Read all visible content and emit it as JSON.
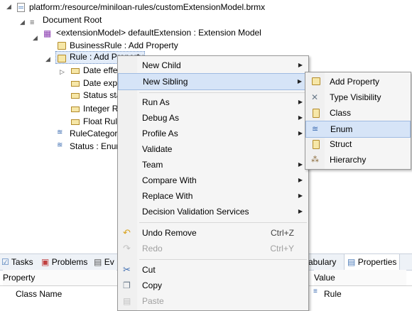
{
  "tree": {
    "file_path": "platform:/resource/miniloan-rules/customExtensionModel.brmx",
    "document_root": "Document Root",
    "extension_model": "<extensionModel> defaultExtension : Extension Model",
    "business_rule": "BusinessRule : Add Property",
    "rule": "Rule : Add Property",
    "rule_children": [
      "Date effe",
      "Date expi",
      "Status sta",
      "Integer R",
      "Float Rule"
    ],
    "rule_category": "RuleCategory",
    "status": "Status : Enum"
  },
  "context_menu": {
    "new_child": "New Child",
    "new_sibling": "New Sibling",
    "run_as": "Run As",
    "debug_as": "Debug As",
    "profile_as": "Profile As",
    "validate": "Validate",
    "team": "Team",
    "compare_with": "Compare With",
    "replace_with": "Replace With",
    "decision_validation": "Decision Validation Services",
    "undo_remove": "Undo Remove",
    "undo_shortcut": "Ctrl+Z",
    "redo": "Redo",
    "redo_shortcut": "Ctrl+Y",
    "cut": "Cut",
    "copy": "Copy",
    "paste": "Paste"
  },
  "submenu": {
    "add_property": "Add Property",
    "type_visibility": "Type Visibility",
    "class": "Class",
    "enum": "Enum",
    "struct": "Struct",
    "hierarchy": "Hierarchy"
  },
  "bottom_tabs": {
    "tasks": "Tasks",
    "problems": "Problems",
    "ev": "Ev",
    "vocabulary": "cabulary",
    "properties": "Properties"
  },
  "properties_table": {
    "col_property": "Property",
    "col_value": "Value",
    "row_property": "Class Name",
    "row_value": "Rule"
  },
  "colors": {
    "highlight": "#d6e4f7",
    "highlight_border": "#9fbbe2",
    "menu_bg": "#f5f5f5"
  }
}
